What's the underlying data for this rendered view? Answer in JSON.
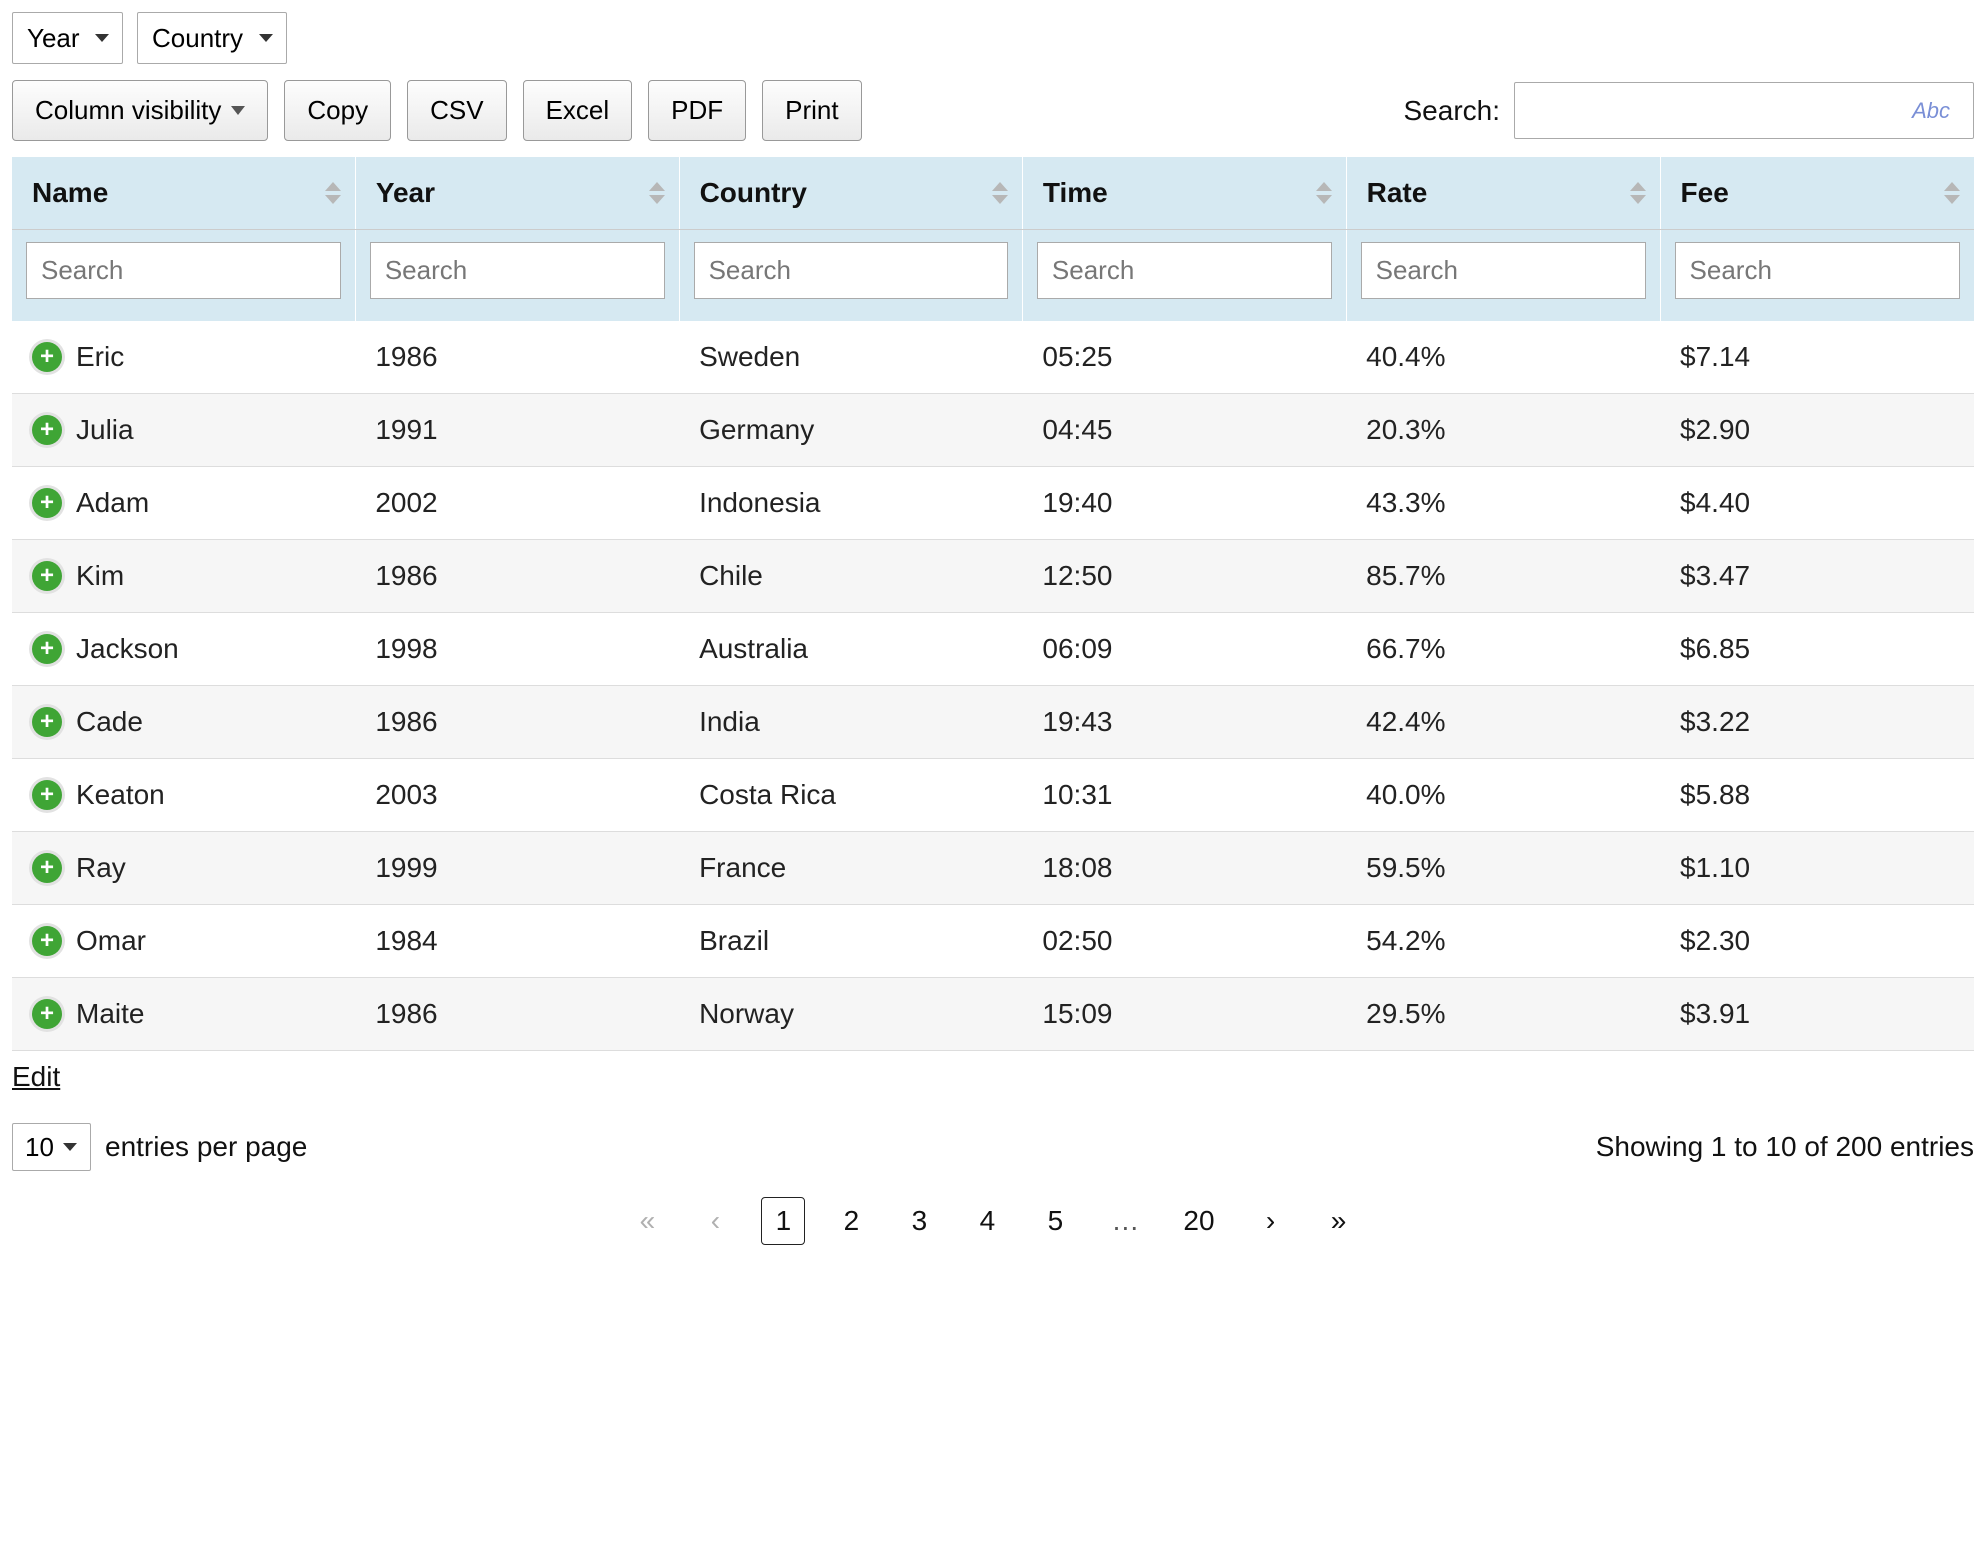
{
  "filters": {
    "select1": "Year",
    "select2": "Country"
  },
  "toolbar": {
    "column_visibility": "Column visibility",
    "copy": "Copy",
    "csv": "CSV",
    "excel": "Excel",
    "pdf": "PDF",
    "print": "Print"
  },
  "search": {
    "label": "Search:",
    "hint": "Abc",
    "placeholder": ""
  },
  "columns": [
    {
      "key": "name",
      "label": "Name",
      "search_placeholder": "Search"
    },
    {
      "key": "year",
      "label": "Year",
      "search_placeholder": "Search"
    },
    {
      "key": "country",
      "label": "Country",
      "search_placeholder": "Search"
    },
    {
      "key": "time",
      "label": "Time",
      "search_placeholder": "Search"
    },
    {
      "key": "rate",
      "label": "Rate",
      "search_placeholder": "Search"
    },
    {
      "key": "fee",
      "label": "Fee",
      "search_placeholder": "Search"
    }
  ],
  "rows": [
    {
      "name": "Eric",
      "year": "1986",
      "country": "Sweden",
      "time": "05:25",
      "rate": "40.4%",
      "fee": "$7.14"
    },
    {
      "name": "Julia",
      "year": "1991",
      "country": "Germany",
      "time": "04:45",
      "rate": "20.3%",
      "fee": "$2.90"
    },
    {
      "name": "Adam",
      "year": "2002",
      "country": "Indonesia",
      "time": "19:40",
      "rate": "43.3%",
      "fee": "$4.40"
    },
    {
      "name": "Kim",
      "year": "1986",
      "country": "Chile",
      "time": "12:50",
      "rate": "85.7%",
      "fee": "$3.47"
    },
    {
      "name": "Jackson",
      "year": "1998",
      "country": "Australia",
      "time": "06:09",
      "rate": "66.7%",
      "fee": "$6.85"
    },
    {
      "name": "Cade",
      "year": "1986",
      "country": "India",
      "time": "19:43",
      "rate": "42.4%",
      "fee": "$3.22"
    },
    {
      "name": "Keaton",
      "year": "2003",
      "country": "Costa Rica",
      "time": "10:31",
      "rate": "40.0%",
      "fee": "$5.88"
    },
    {
      "name": "Ray",
      "year": "1999",
      "country": "France",
      "time": "18:08",
      "rate": "59.5%",
      "fee": "$1.10"
    },
    {
      "name": "Omar",
      "year": "1984",
      "country": "Brazil",
      "time": "02:50",
      "rate": "54.2%",
      "fee": "$2.30"
    },
    {
      "name": "Maite",
      "year": "1986",
      "country": "Norway",
      "time": "15:09",
      "rate": "29.5%",
      "fee": "$3.91"
    }
  ],
  "edit_label": "Edit",
  "per_page": {
    "value": "10",
    "label": "entries per page"
  },
  "info": "Showing 1 to 10 of 200 entries",
  "pager": {
    "first": "«",
    "prev": "‹",
    "next": "›",
    "last": "»",
    "ellipsis": "…",
    "pages": [
      "1",
      "2",
      "3",
      "4",
      "5"
    ],
    "last_page": "20",
    "current": "1"
  }
}
